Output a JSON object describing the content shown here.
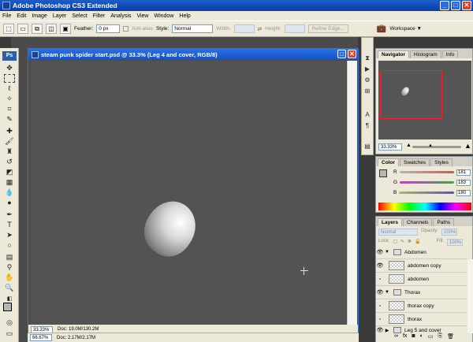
{
  "app": {
    "title": "Adobe Photoshop CS3 Extended",
    "win_buttons": [
      "_",
      "□",
      "✕"
    ]
  },
  "menu": [
    "File",
    "Edit",
    "Image",
    "Layer",
    "Select",
    "Filter",
    "Analysis",
    "View",
    "Window",
    "Help"
  ],
  "options": {
    "feather_label": "Feather:",
    "feather_value": "0 px",
    "antialias_label": "Anti-alias",
    "style_label": "Style:",
    "style_value": "Normal",
    "width_label": "Width:",
    "height_label": "Height:",
    "refine_label": "Refine Edge...",
    "workspace_label": "Workspace ▼"
  },
  "document": {
    "title": "steam punk spider start.psd @ 33.3% (Leg 4 and cover, RGB/8)",
    "zoom": "33.33%",
    "doc_size": "Doc: 19.0M/130.2M"
  },
  "app_status": {
    "zoom": "66.67%",
    "doc_size": "Doc: 2.17M/2.17M"
  },
  "navigator": {
    "tabs": [
      "Navigator",
      "Histogram",
      "Info"
    ],
    "zoom": "33.33%"
  },
  "color": {
    "tabs": [
      "Color",
      "Swatches",
      "Styles"
    ],
    "channels": [
      {
        "label": "R",
        "value": "181",
        "color": "#e05050"
      },
      {
        "label": "G",
        "value": "183",
        "color": "#50a050"
      },
      {
        "label": "B",
        "value": "180",
        "color": "#5050e0"
      }
    ]
  },
  "layers": {
    "tabs": [
      "Layers",
      "Channels",
      "Paths"
    ],
    "blend_mode": "Normal",
    "opacity_label": "Opacity:",
    "opacity_value": "100%",
    "lock_label": "Lock:",
    "fill_label": "Fill:",
    "fill_value": "100%",
    "items": [
      {
        "name": "Abdomen",
        "type": "group",
        "visible": true
      },
      {
        "name": "abdomen copy",
        "type": "layer",
        "visible": true
      },
      {
        "name": "abdomen",
        "type": "layer",
        "visible": false
      },
      {
        "name": "Thorax",
        "type": "group",
        "visible": true
      },
      {
        "name": "thorax copy",
        "type": "layer",
        "visible": false
      },
      {
        "name": "thorax",
        "type": "layer",
        "visible": false
      },
      {
        "name": "Leg 5 and cover",
        "type": "group",
        "visible": true
      }
    ]
  }
}
